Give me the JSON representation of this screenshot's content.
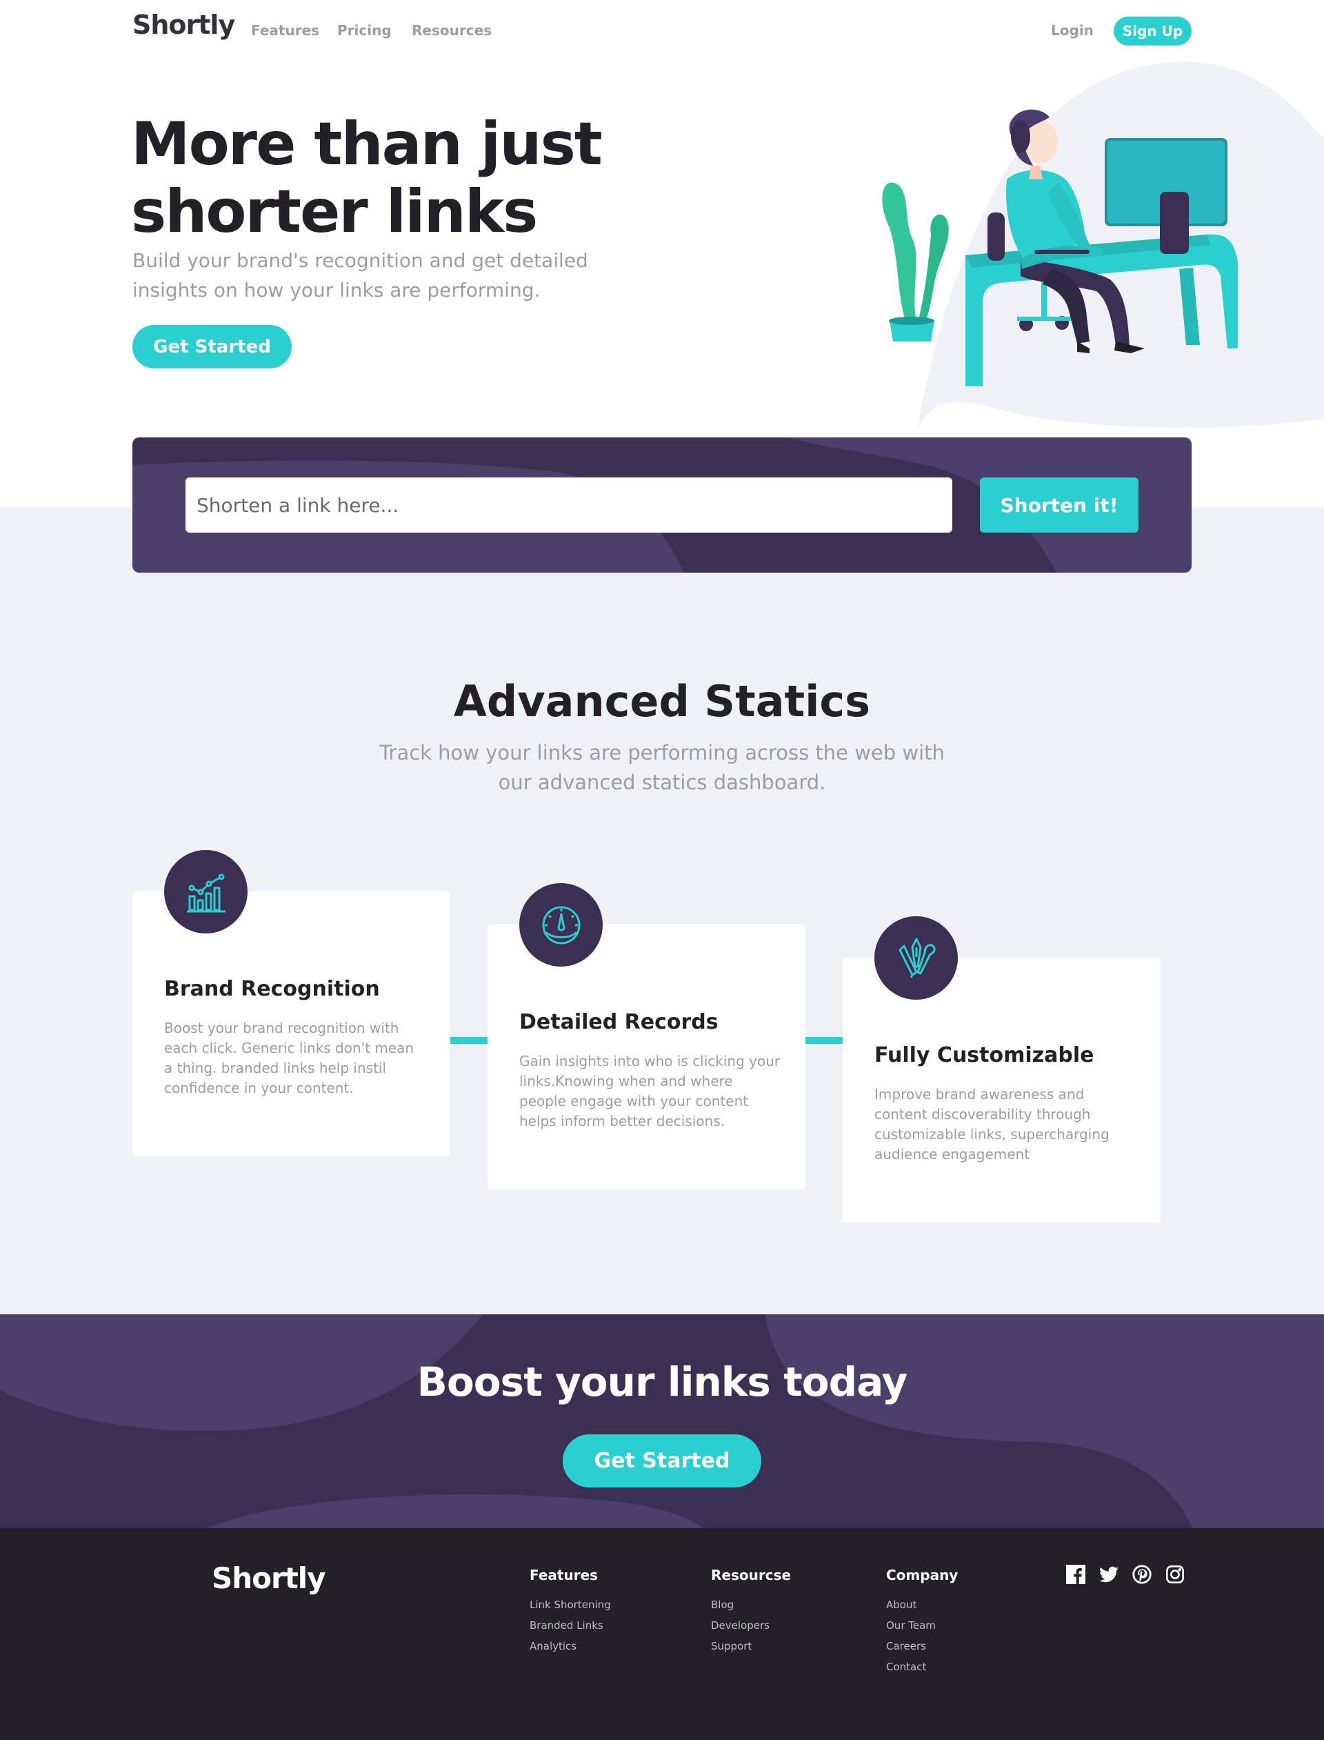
{
  "header": {
    "logo": "Shortly",
    "nav": [
      "Features",
      "Pricing",
      "Resources"
    ],
    "login": "Login",
    "signup": "Sign Up"
  },
  "hero": {
    "title_line1": "More than just",
    "title_line2": "shorter links",
    "subtitle": "Build your brand's recognition and get detailed insights on how your links are performing.",
    "cta": "Get Started",
    "illustration": "person-working-illustration"
  },
  "shorten": {
    "placeholder": "Shorten a link here...",
    "button": "Shorten it!"
  },
  "stats": {
    "title": "Advanced Statics",
    "subtitle": "Track how your links are performing across the web with our advanced statics dashboard.",
    "cards": [
      {
        "icon": "bar-chart-icon",
        "title": "Brand Recognition",
        "text": "Boost your brand recognition with each click. Generic links don't mean a thing. branded links help instil confidence in your content."
      },
      {
        "icon": "gauge-icon",
        "title": "Detailed Records",
        "text": "Gain insights into who is clicking your links.Knowing when and where people engage with your content helps inform better decisions."
      },
      {
        "icon": "pen-tools-icon",
        "title": "Fully Customizable",
        "text": "Improve brand awareness and content discoverability through customizable links, supercharging audience engagement"
      }
    ]
  },
  "boost": {
    "title": "Boost your links today",
    "cta": "Get Started"
  },
  "footer": {
    "logo": "Shortly",
    "columns": [
      {
        "heading": "Features",
        "links": [
          "Link Shortening",
          "Branded Links",
          "Analytics"
        ]
      },
      {
        "heading": "Resourcse",
        "links": [
          "Blog",
          "Developers",
          "Support"
        ]
      },
      {
        "heading": "Company",
        "links": [
          "About",
          "Our Team",
          "Careers",
          "Contact"
        ]
      }
    ],
    "socials": [
      "facebook-icon",
      "twitter-icon",
      "pinterest-icon",
      "instagram-icon"
    ]
  },
  "colors": {
    "cyan": "#2acfcf",
    "dark_violet": "#3b3054",
    "very_dark_violet": "#232127",
    "gray": "#9e9aa8",
    "light_gray": "#eff1f7"
  }
}
